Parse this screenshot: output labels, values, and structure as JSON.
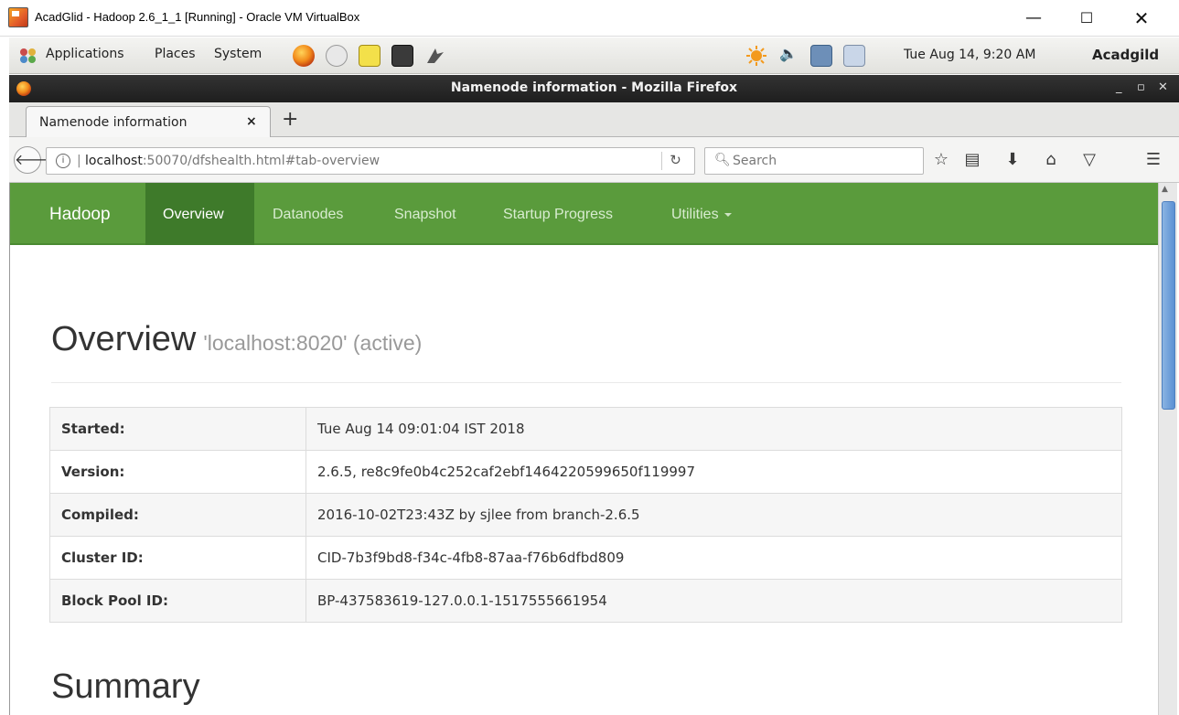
{
  "vbox": {
    "title": "AcadGlid - Hadoop 2.6_1_1 [Running] - Oracle VM VirtualBox",
    "minimize": "—",
    "maximize": "☐",
    "close": "✕"
  },
  "gnome_panel": {
    "menus": [
      "Applications",
      "Places",
      "System"
    ],
    "clock": "Tue Aug 14,  9:20 AM",
    "user": "Acadgild"
  },
  "firefox": {
    "window_title": "Namenode information - Mozilla Firefox",
    "tab_title": "Namenode information",
    "tab_close": "×",
    "new_tab": "+",
    "url_host": "localhost",
    "url_rest": ":50070/dfshealth.html#tab-overview",
    "search_placeholder": "Search",
    "window_controls": [
      "_",
      "▫",
      "✕"
    ]
  },
  "hadoop": {
    "brand": "Hadoop",
    "nav": {
      "overview": "Overview",
      "datanodes": "Datanodes",
      "snapshot": "Snapshot",
      "startup_progress": "Startup Progress",
      "utilities": "Utilities"
    },
    "overview_title": "Overview",
    "overview_subtitle": "'localhost:8020' (active)",
    "rows": [
      {
        "key": "Started:",
        "value": "Tue Aug 14 09:01:04 IST 2018"
      },
      {
        "key": "Version:",
        "value": "2.6.5, re8c9fe0b4c252caf2ebf1464220599650f119997"
      },
      {
        "key": "Compiled:",
        "value": "2016-10-02T23:43Z by sjlee from branch-2.6.5"
      },
      {
        "key": "Cluster ID:",
        "value": "CID-7b3f9bd8-f34c-4fb8-87aa-f76b6dfbd809"
      },
      {
        "key": "Block Pool ID:",
        "value": "BP-437583619-127.0.0.1-1517555661954"
      }
    ],
    "summary_title": "Summary"
  },
  "colors": {
    "hadoop_green": "#5a9b3c",
    "hadoop_green_active": "#3e7a2a"
  }
}
